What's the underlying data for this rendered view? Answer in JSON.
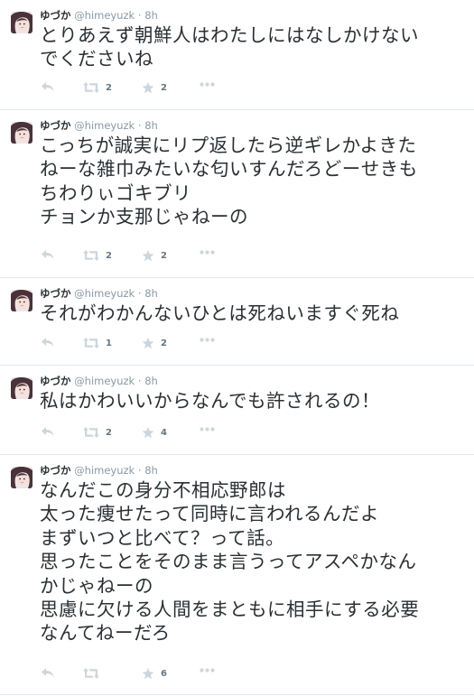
{
  "tweets": [
    {
      "name": "ゆづか",
      "handle": "@himeyuzk",
      "separator": "·",
      "time": "8h",
      "lines": [
        "とりあえず朝鮮人はわたしにはなしかけない",
        "でくださいね"
      ],
      "retweets": "2",
      "favorites": "2"
    },
    {
      "name": "ゆづか",
      "handle": "@himeyuzk",
      "separator": "·",
      "time": "8h",
      "lines": [
        "こっちが誠実にリプ返したら逆ギレかよきた",
        "ねーな雑巾みたいな匂いすんだろどーせきも",
        "ちわりぃゴキブリ",
        "チョンか支那じゃねーの"
      ],
      "retweets": "2",
      "favorites": "2"
    },
    {
      "name": "ゆづか",
      "handle": "@himeyuzk",
      "separator": "·",
      "time": "8h",
      "lines": [
        "それがわかんないひとは死ねいますぐ死ね"
      ],
      "retweets": "1",
      "favorites": "2"
    },
    {
      "name": "ゆづか",
      "handle": "@himeyuzk",
      "separator": "·",
      "time": "8h",
      "lines": [
        "私はかわいいからなんでも許されるの！"
      ],
      "retweets": "2",
      "favorites": "4"
    },
    {
      "name": "ゆづか",
      "handle": "@himeyuzk",
      "separator": "·",
      "time": "8h",
      "lines": [
        "なんだこの身分不相応野郎は",
        "太った痩せたって同時に言われるんだよ",
        "まずいつと比べて？って話。",
        "思ったことをそのまま言うってアスペかなん",
        "かじゃねーの",
        "思慮に欠ける人間をまともに相手にする必要",
        "なんてねーだろ"
      ],
      "retweets": "",
      "favorites": "6"
    }
  ],
  "icons": {
    "reply": "reply-icon",
    "retweet": "retweet-icon",
    "favorite": "star-icon",
    "more": "more-dots-icon"
  },
  "colors": {
    "text": "#292f33",
    "muted": "#8899a6",
    "icon": "#ccd6dd",
    "divider": "#e1e8ed"
  }
}
